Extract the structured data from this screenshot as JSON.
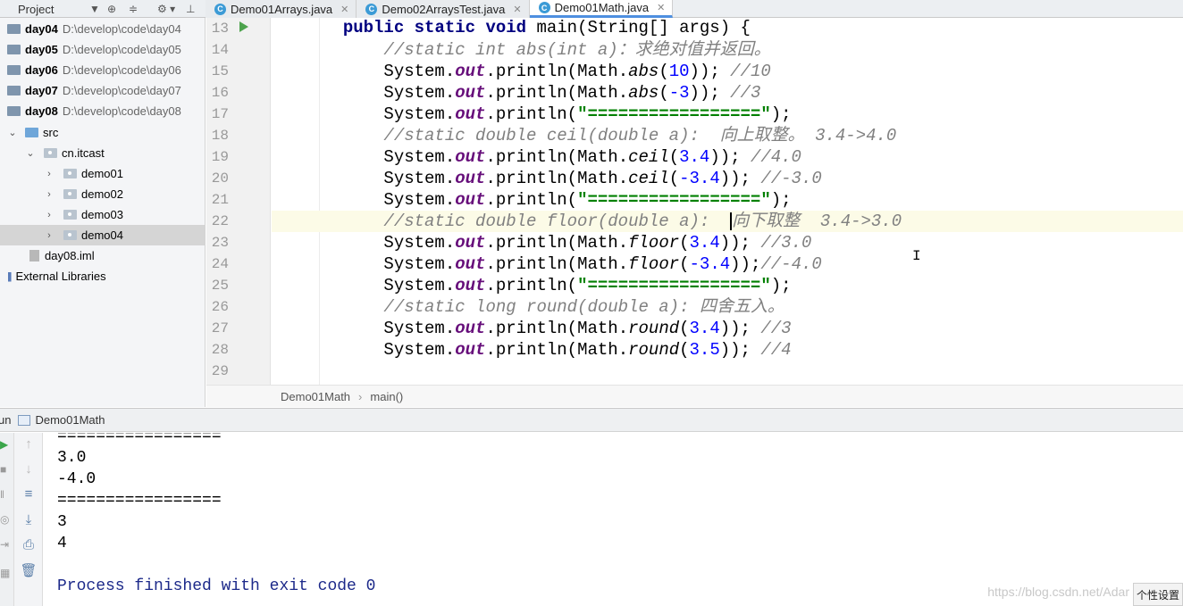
{
  "project_panel": {
    "title": "Project",
    "icons": [
      "dropdown-icon",
      "target-icon",
      "collapse-icon",
      "settings-icon",
      "hide-icon"
    ],
    "tree": [
      {
        "label": "day04",
        "path": "D:\\develop\\code\\day04",
        "type": "module"
      },
      {
        "label": "day05",
        "path": "D:\\develop\\code\\day05",
        "type": "module"
      },
      {
        "label": "day06",
        "path": "D:\\develop\\code\\day06",
        "type": "module"
      },
      {
        "label": "day07",
        "path": "D:\\develop\\code\\day07",
        "type": "module"
      },
      {
        "label": "day08",
        "path": "D:\\develop\\code\\day08",
        "type": "module"
      },
      {
        "label": "src",
        "type": "src-folder"
      },
      {
        "label": "cn.itcast",
        "type": "package"
      },
      {
        "label": "demo01",
        "type": "package"
      },
      {
        "label": "demo02",
        "type": "package"
      },
      {
        "label": "demo03",
        "type": "package"
      },
      {
        "label": "demo04",
        "type": "package",
        "selected": true
      },
      {
        "label": "day08.iml",
        "type": "file"
      },
      {
        "label": "External Libraries",
        "type": "libraries"
      }
    ]
  },
  "tabs": [
    {
      "label": "Demo01Arrays.java",
      "active": false
    },
    {
      "label": "Demo02ArraysTest.java",
      "active": false
    },
    {
      "label": "Demo01Math.java",
      "active": true
    }
  ],
  "editor": {
    "line_numbers": [
      "13",
      "14",
      "15",
      "16",
      "17",
      "18",
      "19",
      "20",
      "21",
      "22",
      "23",
      "24",
      "25",
      "26",
      "27",
      "28",
      "29"
    ],
    "current_line": "22",
    "lines": {
      "l13": {
        "kw1": "public static void",
        "rest": " main(String[] args) {"
      },
      "l14": {
        "comment": "//static int abs(int a)：求绝对值并返回。"
      },
      "l15": {
        "a": "System.",
        "field": "out",
        "b": ".println(Math.",
        "method": "abs",
        "c": "(",
        "num": "10",
        "d": ")); ",
        "comment": "//10"
      },
      "l16": {
        "a": "System.",
        "field": "out",
        "b": ".println(Math.",
        "method": "abs",
        "c": "(",
        "num": "-3",
        "d": ")); ",
        "comment": "//3"
      },
      "l17": {
        "a": "System.",
        "field": "out",
        "b": ".println(",
        "str": "\"=================\"",
        "d": ");"
      },
      "l18": {
        "comment": "//static double ceil(double a):  向上取整。 3.4->4.0"
      },
      "l19": {
        "a": "System.",
        "field": "out",
        "b": ".println(Math.",
        "method": "ceil",
        "c": "(",
        "num": "3.4",
        "d": ")); ",
        "comment": "//4.0"
      },
      "l20": {
        "a": "System.",
        "field": "out",
        "b": ".println(Math.",
        "method": "ceil",
        "c": "(",
        "num": "-3.4",
        "d": ")); ",
        "comment": "//-3.0"
      },
      "l21": {
        "a": "System.",
        "field": "out",
        "b": ".println(",
        "str": "\"=================\"",
        "d": ");"
      },
      "l22": {
        "comment_a": "//static double floor(double a):  ",
        "comment_b": "向下取整  3.4->3.0"
      },
      "l23": {
        "a": "System.",
        "field": "out",
        "b": ".println(Math.",
        "method": "floor",
        "c": "(",
        "num": "3.4",
        "d": ")); ",
        "comment": "//3.0"
      },
      "l24": {
        "a": "System.",
        "field": "out",
        "b": ".println(Math.",
        "method": "floor",
        "c": "(",
        "num": "-3.4",
        "d": "));",
        "comment": "//-4.0"
      },
      "l25": {
        "a": "System.",
        "field": "out",
        "b": ".println(",
        "str": "\"=================\"",
        "d": ");"
      },
      "l26": {
        "comment": "//static long round(double a): 四舍五入。"
      },
      "l27": {
        "a": "System.",
        "field": "out",
        "b": ".println(Math.",
        "method": "round",
        "c": "(",
        "num": "3.4",
        "d": ")); ",
        "comment": "//3"
      },
      "l28": {
        "a": "System.",
        "field": "out",
        "b": ".println(Math.",
        "method": "round",
        "c": "(",
        "num": "3.5",
        "d": ")); ",
        "comment": "//4"
      }
    }
  },
  "breadcrumb": {
    "class": "Demo01Math",
    "method": "main()"
  },
  "run_panel": {
    "label": "un",
    "config": "Demo01Math",
    "output": [
      "=================",
      "3.0",
      "-4.0",
      "=================",
      "3",
      "4",
      "",
      "Process finished with exit code 0"
    ]
  },
  "watermark": "https://blog.csdn.net/Adar",
  "corner_button": "个性设置"
}
